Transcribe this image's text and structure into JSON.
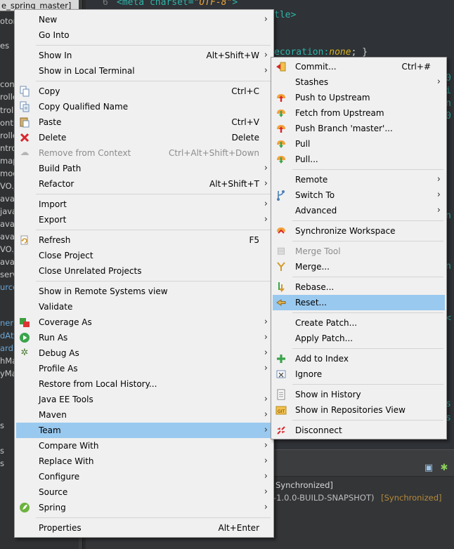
{
  "explorer": {
    "project": "e_spring_master]",
    "rows": [
      "otor",
      "es",
      "con",
      "rolle",
      "troll",
      "ontr",
      "rolle",
      "ntrol",
      "map",
      "mod",
      "VO.j",
      "ava",
      "java",
      "ava",
      "ava",
      "VO.j",
      "ava",
      "serv",
      "urce",
      "ner",
      "dAtt",
      "ardI",
      "hMa",
      "yMa",
      "s",
      "s",
      "s"
    ]
  },
  "editor": {
    "line_number": "6",
    "line6_tag": "<meta",
    "line6_attr": "charset=",
    "line6_value": "\"UTF-8\"",
    "line6_close": ">",
    "line7": "tle>",
    "line9_prop": "ecoration:",
    "line9_value": "none",
    "line9_close": "; }",
    "edge_chars": [
      "0",
      "i",
      "n",
      "0",
      "n",
      "n",
      "<",
      "s",
      "s"
    ]
  },
  "console": {
    "line1": "Synchronized]",
    "line2_text": "r-1.0.0-BUILD-SNAPSHOT)",
    "line2_status": "[Synchronized]",
    "toolbar_icons": [
      "layout-icon",
      "bug-icon"
    ]
  },
  "main_menu": {
    "items": {
      "new": {
        "label": "New",
        "icon": "none"
      },
      "go_into": {
        "label": "Go Into"
      },
      "show_in": {
        "label": "Show In",
        "shortcut": "Alt+Shift+W"
      },
      "show_in_terminal": {
        "label": "Show in Local Terminal"
      },
      "copy": {
        "label": "Copy",
        "shortcut": "Ctrl+C",
        "icon": "copy-icon"
      },
      "copy_qualified": {
        "label": "Copy Qualified Name",
        "icon": "copy-qualified-icon"
      },
      "paste": {
        "label": "Paste",
        "shortcut": "Ctrl+V",
        "icon": "paste-icon"
      },
      "delete": {
        "label": "Delete",
        "shortcut": "Delete",
        "icon": "delete-icon"
      },
      "remove_context": {
        "label": "Remove from Context",
        "shortcut": "Ctrl+Alt+Shift+Down",
        "icon": "remove-context-icon"
      },
      "build_path": {
        "label": "Build Path"
      },
      "refactor": {
        "label": "Refactor",
        "shortcut": "Alt+Shift+T"
      },
      "import": {
        "label": "Import"
      },
      "export": {
        "label": "Export"
      },
      "refresh": {
        "label": "Refresh",
        "shortcut": "F5",
        "icon": "refresh-icon"
      },
      "close_project": {
        "label": "Close Project"
      },
      "close_unrelated": {
        "label": "Close Unrelated Projects"
      },
      "remote_systems": {
        "label": "Show in Remote Systems view"
      },
      "validate": {
        "label": "Validate"
      },
      "coverage_as": {
        "label": "Coverage As",
        "icon": "coverage-icon"
      },
      "run_as": {
        "label": "Run As",
        "icon": "run-icon"
      },
      "debug_as": {
        "label": "Debug As",
        "icon": "debug-icon"
      },
      "profile_as": {
        "label": "Profile As"
      },
      "restore_history": {
        "label": "Restore from Local History..."
      },
      "java_ee_tools": {
        "label": "Java EE Tools"
      },
      "maven": {
        "label": "Maven"
      },
      "team": {
        "label": "Team"
      },
      "compare_with": {
        "label": "Compare With"
      },
      "replace_with": {
        "label": "Replace With"
      },
      "configure": {
        "label": "Configure"
      },
      "source": {
        "label": "Source"
      },
      "spring": {
        "label": "Spring",
        "icon": "spring-icon"
      },
      "properties": {
        "label": "Properties",
        "shortcut": "Alt+Enter"
      }
    },
    "submenu_arrow": "›"
  },
  "team_menu": {
    "items": {
      "commit": {
        "label": "Commit...",
        "shortcut": "Ctrl+#",
        "icon": "commit-icon"
      },
      "stashes": {
        "label": "Stashes"
      },
      "push_upstream": {
        "label": "Push to Upstream",
        "icon": "push-upstream-icon"
      },
      "fetch_upstream": {
        "label": "Fetch from Upstream",
        "icon": "fetch-upstream-icon"
      },
      "push_branch": {
        "label": "Push Branch 'master'...",
        "icon": "push-branch-icon"
      },
      "pull": {
        "label": "Pull",
        "icon": "pull-icon"
      },
      "pull_dots": {
        "label": "Pull...",
        "icon": "pull-dialog-icon"
      },
      "remote": {
        "label": "Remote"
      },
      "switch_to": {
        "label": "Switch To",
        "icon": "switch-branch-icon"
      },
      "advanced": {
        "label": "Advanced"
      },
      "synchronize": {
        "label": "Synchronize Workspace",
        "icon": "synchronize-icon"
      },
      "merge_tool": {
        "label": "Merge Tool",
        "icon": "merge-tool-icon"
      },
      "merge": {
        "label": "Merge...",
        "icon": "merge-icon"
      },
      "rebase": {
        "label": "Rebase...",
        "icon": "rebase-icon"
      },
      "reset": {
        "label": "Reset...",
        "icon": "reset-icon"
      },
      "create_patch": {
        "label": "Create Patch..."
      },
      "apply_patch": {
        "label": "Apply Patch..."
      },
      "add_index": {
        "label": "Add to Index",
        "icon": "add-index-icon"
      },
      "ignore": {
        "label": "Ignore",
        "icon": "ignore-icon"
      },
      "show_history": {
        "label": "Show in History",
        "icon": "history-icon"
      },
      "show_repos": {
        "label": "Show in Repositories View",
        "icon": "repositories-icon"
      },
      "disconnect": {
        "label": "Disconnect",
        "icon": "disconnect-icon"
      }
    }
  },
  "colors": {
    "menu_bg": "#f0f0f0",
    "highlight": "#99c9ef",
    "disabled_text": "#8c8c8c",
    "editor_bg": "#2f3236",
    "code_tag": "#2fb4a9",
    "code_string": "#e8a43a",
    "code_keyword": "#d8b31e"
  }
}
